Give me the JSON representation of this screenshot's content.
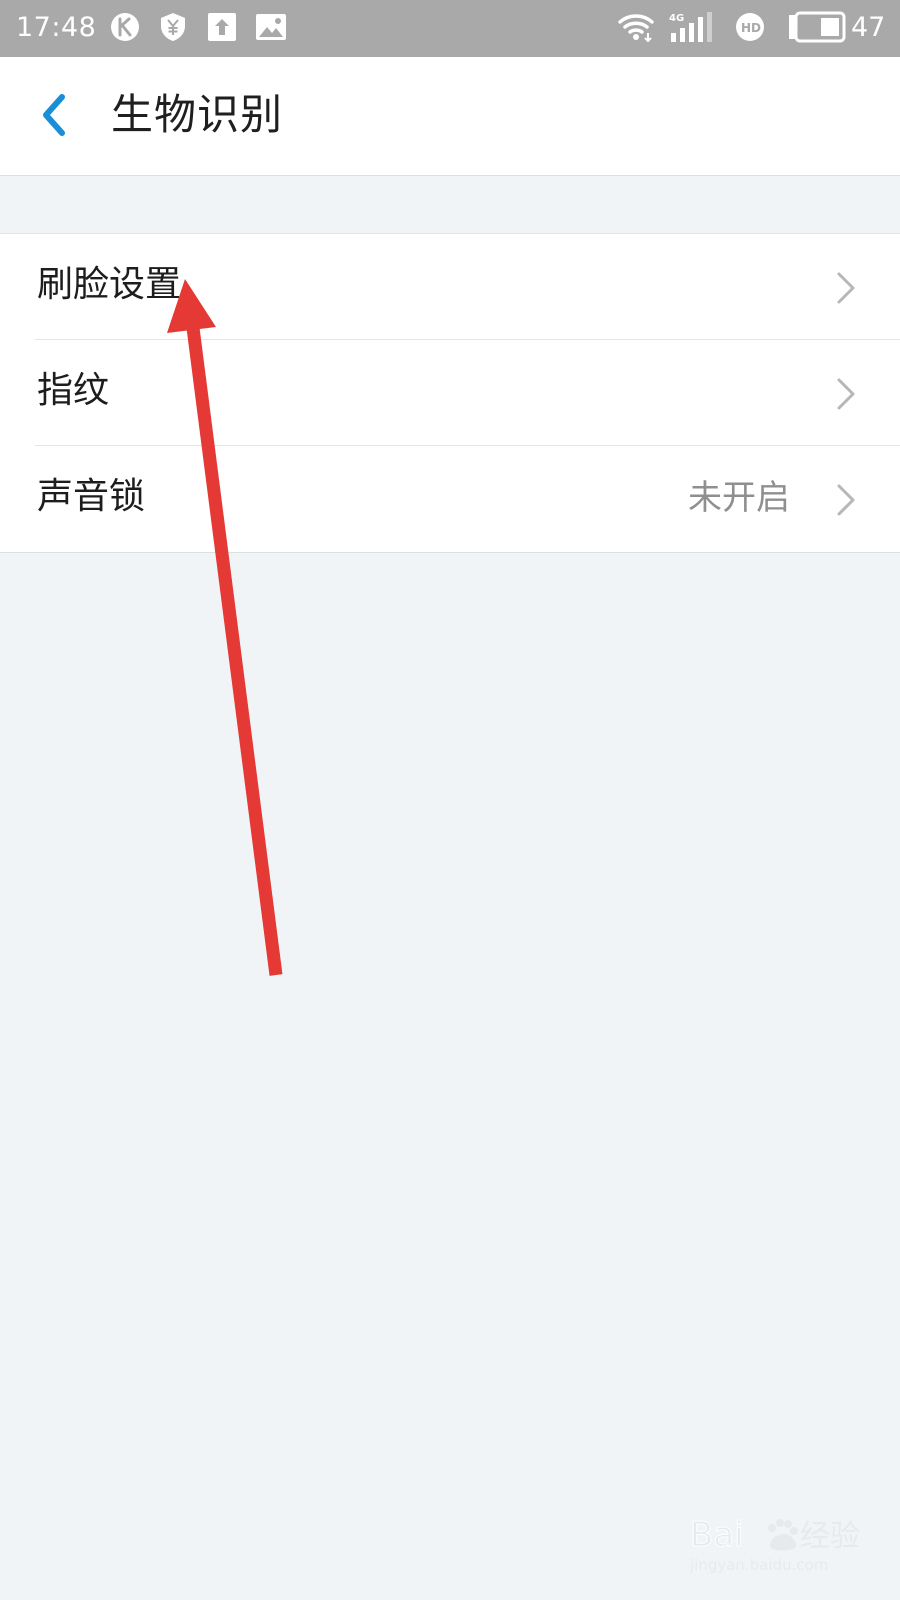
{
  "status_bar": {
    "time": "17:48",
    "battery_level": "47",
    "left_icons": [
      "k-app-icon",
      "yen-shield-icon",
      "upload-icon",
      "image-icon"
    ],
    "right_icons": [
      "wifi-icon",
      "signal-4g-icon",
      "hd-icon",
      "battery-icon"
    ]
  },
  "header": {
    "title": "生物识别",
    "back_icon": "chevron-left-icon",
    "accent_color": "#1a8fd8"
  },
  "settings": {
    "items": [
      {
        "label": "刷脸设置",
        "value": ""
      },
      {
        "label": "指纹",
        "value": ""
      },
      {
        "label": "声音锁",
        "value": "未开启"
      }
    ]
  },
  "annotation": {
    "arrow_color": "#e53935"
  },
  "watermark": {
    "logo_text": "Baidu经验",
    "url": "jingyan.baidu.com"
  }
}
